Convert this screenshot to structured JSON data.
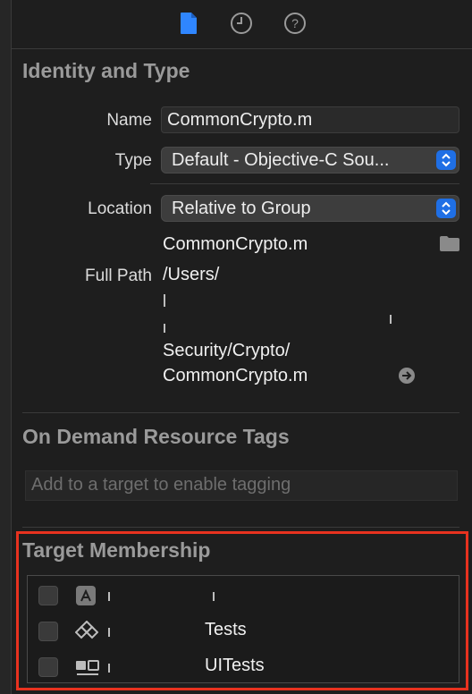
{
  "toolbar": {
    "icons": [
      "file-inspector-icon",
      "history-icon",
      "help-icon"
    ],
    "active_color": "#2f86ff"
  },
  "identity": {
    "title": "Identity and Type",
    "name_label": "Name",
    "name_value": "CommonCrypto.m",
    "type_label": "Type",
    "type_value": "Default - Objective-C Sou...",
    "location_label": "Location",
    "location_value": "Relative to Group",
    "file_name": "CommonCrypto.m",
    "full_path_label": "Full Path",
    "full_path_lines": [
      "/Users/",
      "Security/Crypto/",
      "CommonCrypto.m"
    ]
  },
  "tags": {
    "title": "On Demand Resource Tags",
    "placeholder": "Add to a target to enable tagging"
  },
  "membership": {
    "title": "Target Membership",
    "highlight_color": "#e8321f",
    "targets": [
      {
        "icon": "app-store-icon",
        "name": "",
        "checked": false
      },
      {
        "icon": "test-target-icon",
        "name": "Tests",
        "checked": false
      },
      {
        "icon": "ui-test-target-icon",
        "name": "UITests",
        "checked": false
      }
    ]
  }
}
